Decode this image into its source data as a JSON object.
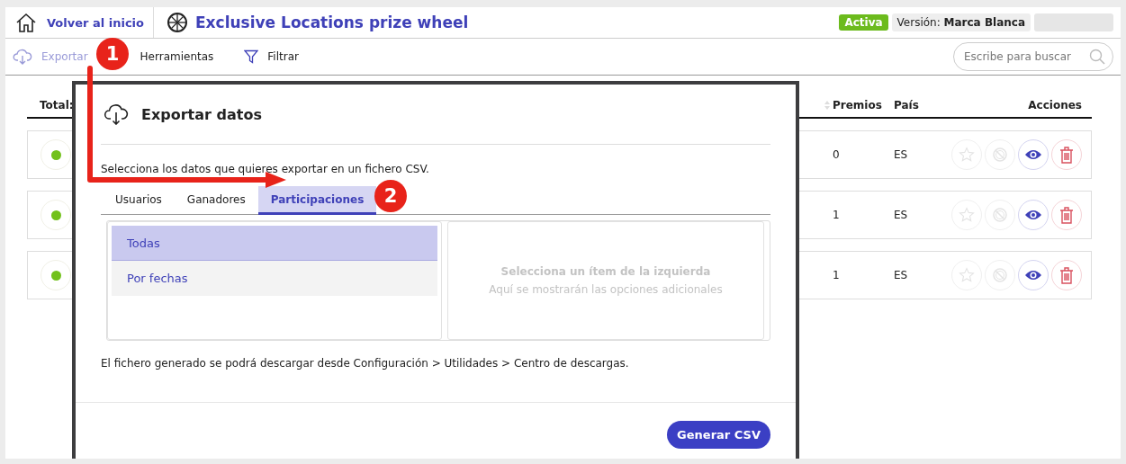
{
  "header": {
    "home_link": "Volver al inicio",
    "title": "Exclusive Locations prize wheel",
    "status_badge": "Activa",
    "version_label": "Versión:",
    "version_value": "Marca Blanca"
  },
  "toolbar": {
    "items": [
      {
        "label": "Exportar",
        "kind": "export",
        "active": true
      },
      {
        "label": "Herramientas",
        "kind": "tools",
        "active": false
      },
      {
        "label": "Filtrar",
        "kind": "filter",
        "active": false
      }
    ],
    "search": {
      "placeholder": "Escribe para buscar"
    }
  },
  "table": {
    "total_label": "Total:",
    "columns": [
      "Premios",
      "País",
      "Acciones"
    ],
    "rows": [
      {
        "online": true,
        "premios": "0",
        "pais": "ES"
      },
      {
        "online": true,
        "premios": "1",
        "pais": "ES"
      },
      {
        "online": true,
        "premios": "1",
        "pais": "ES"
      }
    ]
  },
  "dialog": {
    "title": "Exportar datos",
    "description": "Selecciona los datos que quieres exportar en un fichero CSV.",
    "tabs": [
      {
        "label": "Usuarios",
        "selected": false
      },
      {
        "label": "Ganadores",
        "selected": false
      },
      {
        "label": "Participaciones",
        "selected": true
      }
    ],
    "options": [
      {
        "label": "Todas",
        "selected": true
      },
      {
        "label": "Por fechas",
        "selected": false
      }
    ],
    "details_title": "Selecciona un ítem de la izquierda",
    "details_hint": "Aquí se mostrarán las opciones adicionales",
    "note": "El fichero generado se podrá descargar desde Configuración > Utilidades > Centro de descargas.",
    "primary_button": "Generar CSV"
  },
  "annotations": [
    {
      "label": "1"
    },
    {
      "label": "2"
    }
  ]
}
